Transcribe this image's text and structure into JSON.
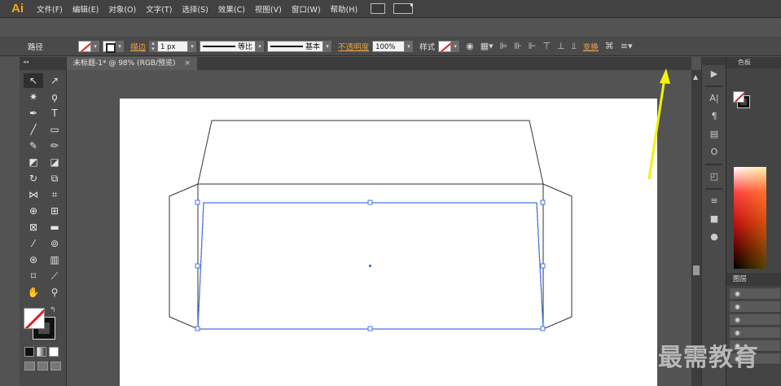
{
  "app": {
    "logo": "Ai"
  },
  "menu": [
    "文件(F)",
    "编辑(E)",
    "对象(O)",
    "文字(T)",
    "选择(S)",
    "效果(C)",
    "视图(V)",
    "窗口(W)",
    "帮助(H)"
  ],
  "control_bar": {
    "selection_label": "路径",
    "stroke_label": "描边",
    "stroke_weight": "1 px",
    "profile_label": "等比",
    "brush_label": "基本",
    "opacity_label": "不透明度",
    "opacity_value": "100%",
    "style_label": "样式",
    "transform_label": "变换"
  },
  "document_tab": {
    "title": "未标题-1* @ 98% (RGB/预览)",
    "close": "×"
  },
  "panels": {
    "color_tab": "色板",
    "layers_tab": "图层"
  },
  "colors": {
    "selection": "#4a76e0",
    "arrow": "#f2f20a",
    "accent_orange": "#f7a51c"
  },
  "watermark": "最需教育"
}
